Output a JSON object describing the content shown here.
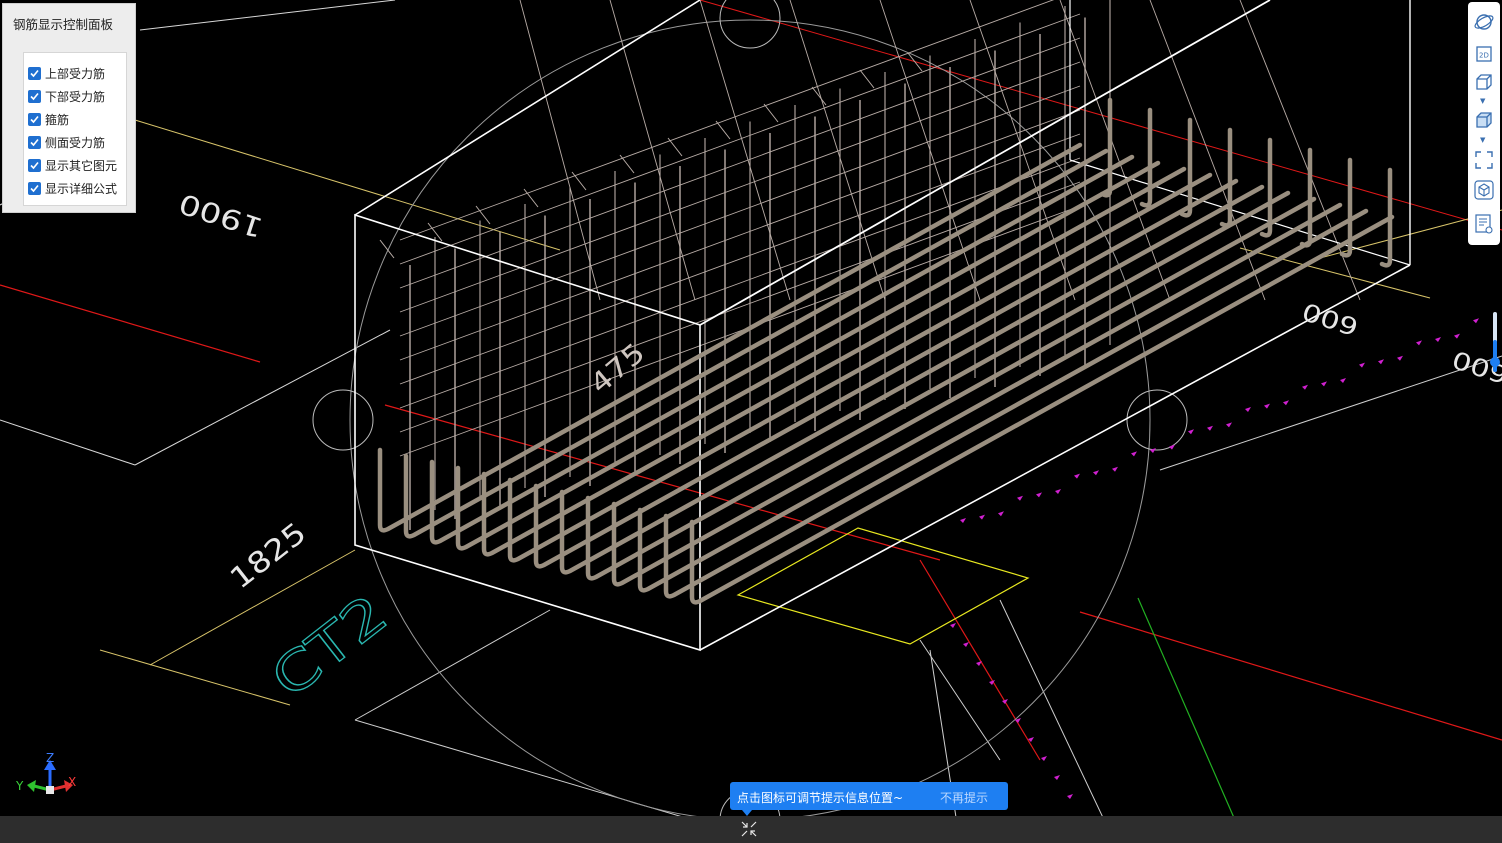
{
  "panel": {
    "title": "钢筋显示控制面板",
    "options": [
      {
        "label": "上部受力筋",
        "checked": true
      },
      {
        "label": "下部受力筋",
        "checked": true
      },
      {
        "label": "箍筋",
        "checked": true
      },
      {
        "label": "侧面受力筋",
        "checked": true
      },
      {
        "label": "显示其它图元",
        "checked": true
      },
      {
        "label": "显示详细公式",
        "checked": true
      }
    ]
  },
  "drawing": {
    "dim_top": "1900",
    "dim_left": "1825",
    "dim_right": "600",
    "dim_edge": "600",
    "dim_inner": "475",
    "element_code": "CT2",
    "axis_labels": {
      "x": "X",
      "y": "Y",
      "z": "Z"
    }
  },
  "toolbar": {
    "icons": [
      "orbit-icon",
      "2d-view-icon",
      "3d-wireframe-icon",
      "3d-solid-icon",
      "fit-view-icon",
      "view-cube-icon",
      "display-settings-icon"
    ],
    "label_2d": "2D"
  },
  "tip": {
    "text": "点击图标可调节提示信息位置~",
    "dismiss": "不再提示"
  },
  "colors": {
    "rebar": "#9a8f80",
    "stirrup": "#b8aca6",
    "outline": "#ffffff",
    "axis_red": "#e01818",
    "dim_yellow": "#d8c46a",
    "accent_blue": "#1e7ff2",
    "magenta": "#d020d0",
    "code_cyan": "#2ab7b0"
  }
}
